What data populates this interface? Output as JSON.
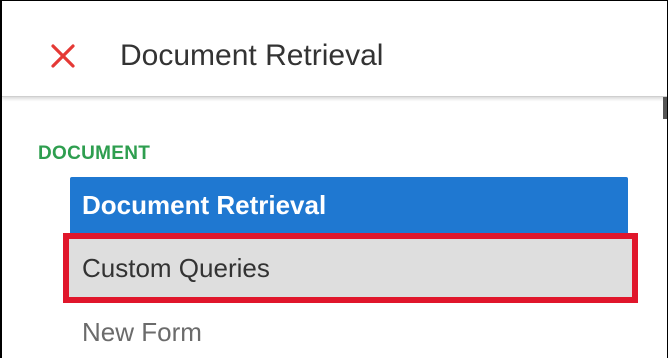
{
  "header": {
    "title": "Document Retrieval",
    "close_icon": "close-icon",
    "close_color": "#e53935"
  },
  "section": {
    "label": "DOCUMENT",
    "label_color": "#2e9e4f"
  },
  "menu": {
    "items": [
      {
        "label": "Document Retrieval",
        "state": "selected"
      },
      {
        "label": "Custom Queries",
        "state": "highlighted"
      },
      {
        "label": "New Form",
        "state": "normal"
      }
    ],
    "selected_color": "#1f78d1",
    "highlight_outline_color": "#e0162b"
  }
}
